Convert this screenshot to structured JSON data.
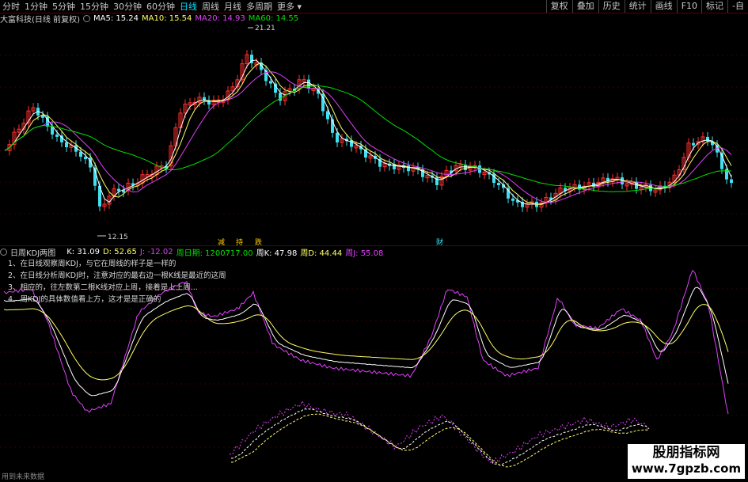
{
  "toolbar": {
    "periods": [
      "分时",
      "1分钟",
      "5分钟",
      "15分钟",
      "30分钟",
      "60分钟",
      "日线",
      "周线",
      "月线",
      "多周期",
      "更多"
    ],
    "active_period": "日线",
    "right_buttons": [
      "复权",
      "叠加",
      "历史",
      "统计",
      "画线",
      "F10",
      "标记",
      "-自"
    ]
  },
  "main_chart": {
    "stock_title": "大富科技(日线 前复权)",
    "ma": [
      {
        "label": "MA5: 15.24",
        "color": "#ffffff"
      },
      {
        "label": "MA10: 15.54",
        "color": "#ffff66"
      },
      {
        "label": "MA20: 14.93",
        "color": "#e040fb"
      },
      {
        "label": "MA60: 14.55",
        "color": "#00e000"
      }
    ],
    "high_label": "21.21",
    "low_label": "12.15",
    "markers": [
      "减",
      "持",
      "跌",
      "财"
    ]
  },
  "indicator": {
    "title": "日周KDJ两图",
    "values": [
      {
        "label": "K: 31.09",
        "color": "#ffffff"
      },
      {
        "label": "D: 52.65",
        "color": "#ffff66"
      },
      {
        "label": "J: -12.02",
        "color": "#e040fb"
      },
      {
        "label": "周日期: 1200717.00",
        "color": "#00e000"
      },
      {
        "label": "周K: 47.98",
        "color": "#ffffff"
      },
      {
        "label": "周D: 44.44",
        "color": "#ffff66"
      },
      {
        "label": "周J: 55.08",
        "color": "#e040fb"
      }
    ],
    "notes": [
      "1、在日线观察周KDJ，与它在周线的样子是一样的",
      "2、在日线分析周KDJ时，注意对应的最右边一根K线是最近的这周",
      "3、相应的，往左数第二根K线对应上周，接着是上上周...",
      "4、周KDJ的具体数值看上方，这才是是正确的"
    ]
  },
  "footer": {
    "bottom_note": "用到未来数据",
    "watermark_cn": "股朋指标网",
    "watermark_url": "www.7gpzb.com"
  },
  "colors": {
    "up": "#ff3030",
    "down": "#40e0f0",
    "ma5": "#ffffff",
    "ma10": "#ffff66",
    "ma20": "#e040fb",
    "ma60": "#00e000"
  }
}
